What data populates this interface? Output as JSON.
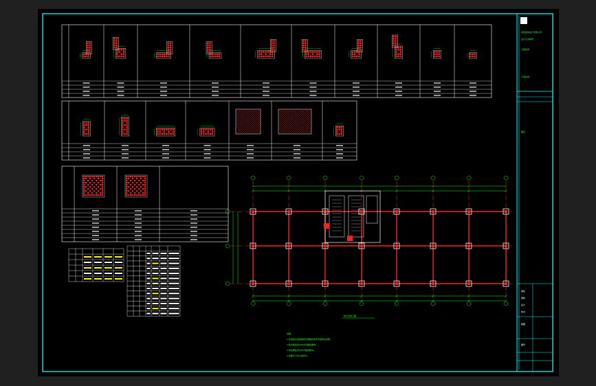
{
  "title_block": {
    "lines": [
      "建筑结构设计有限公司",
      "设计证书编号",
      "工程名称",
      "子项名称",
      "图名",
      "审定",
      "审核",
      "设计",
      "校对",
      "制图",
      "图号"
    ]
  },
  "plan": {
    "caption": "柱平法施工图"
  },
  "notes": {
    "heading": "说明:",
    "lines": [
      "1.柱混凝土强度等级及钢筋构造详见结构总说明。",
      "2.柱纵筋连接方式详见图集要求。",
      "3.未注明柱定位均为轴线居中。",
      "4.本图尺寸均以毫米计。"
    ]
  },
  "colors": {
    "frame": "#00ffff",
    "rebar": "#ff2020",
    "grid": "#ff3030",
    "dim": "#00ff00",
    "table": "#ffffff",
    "highlight": "#ffff00"
  }
}
